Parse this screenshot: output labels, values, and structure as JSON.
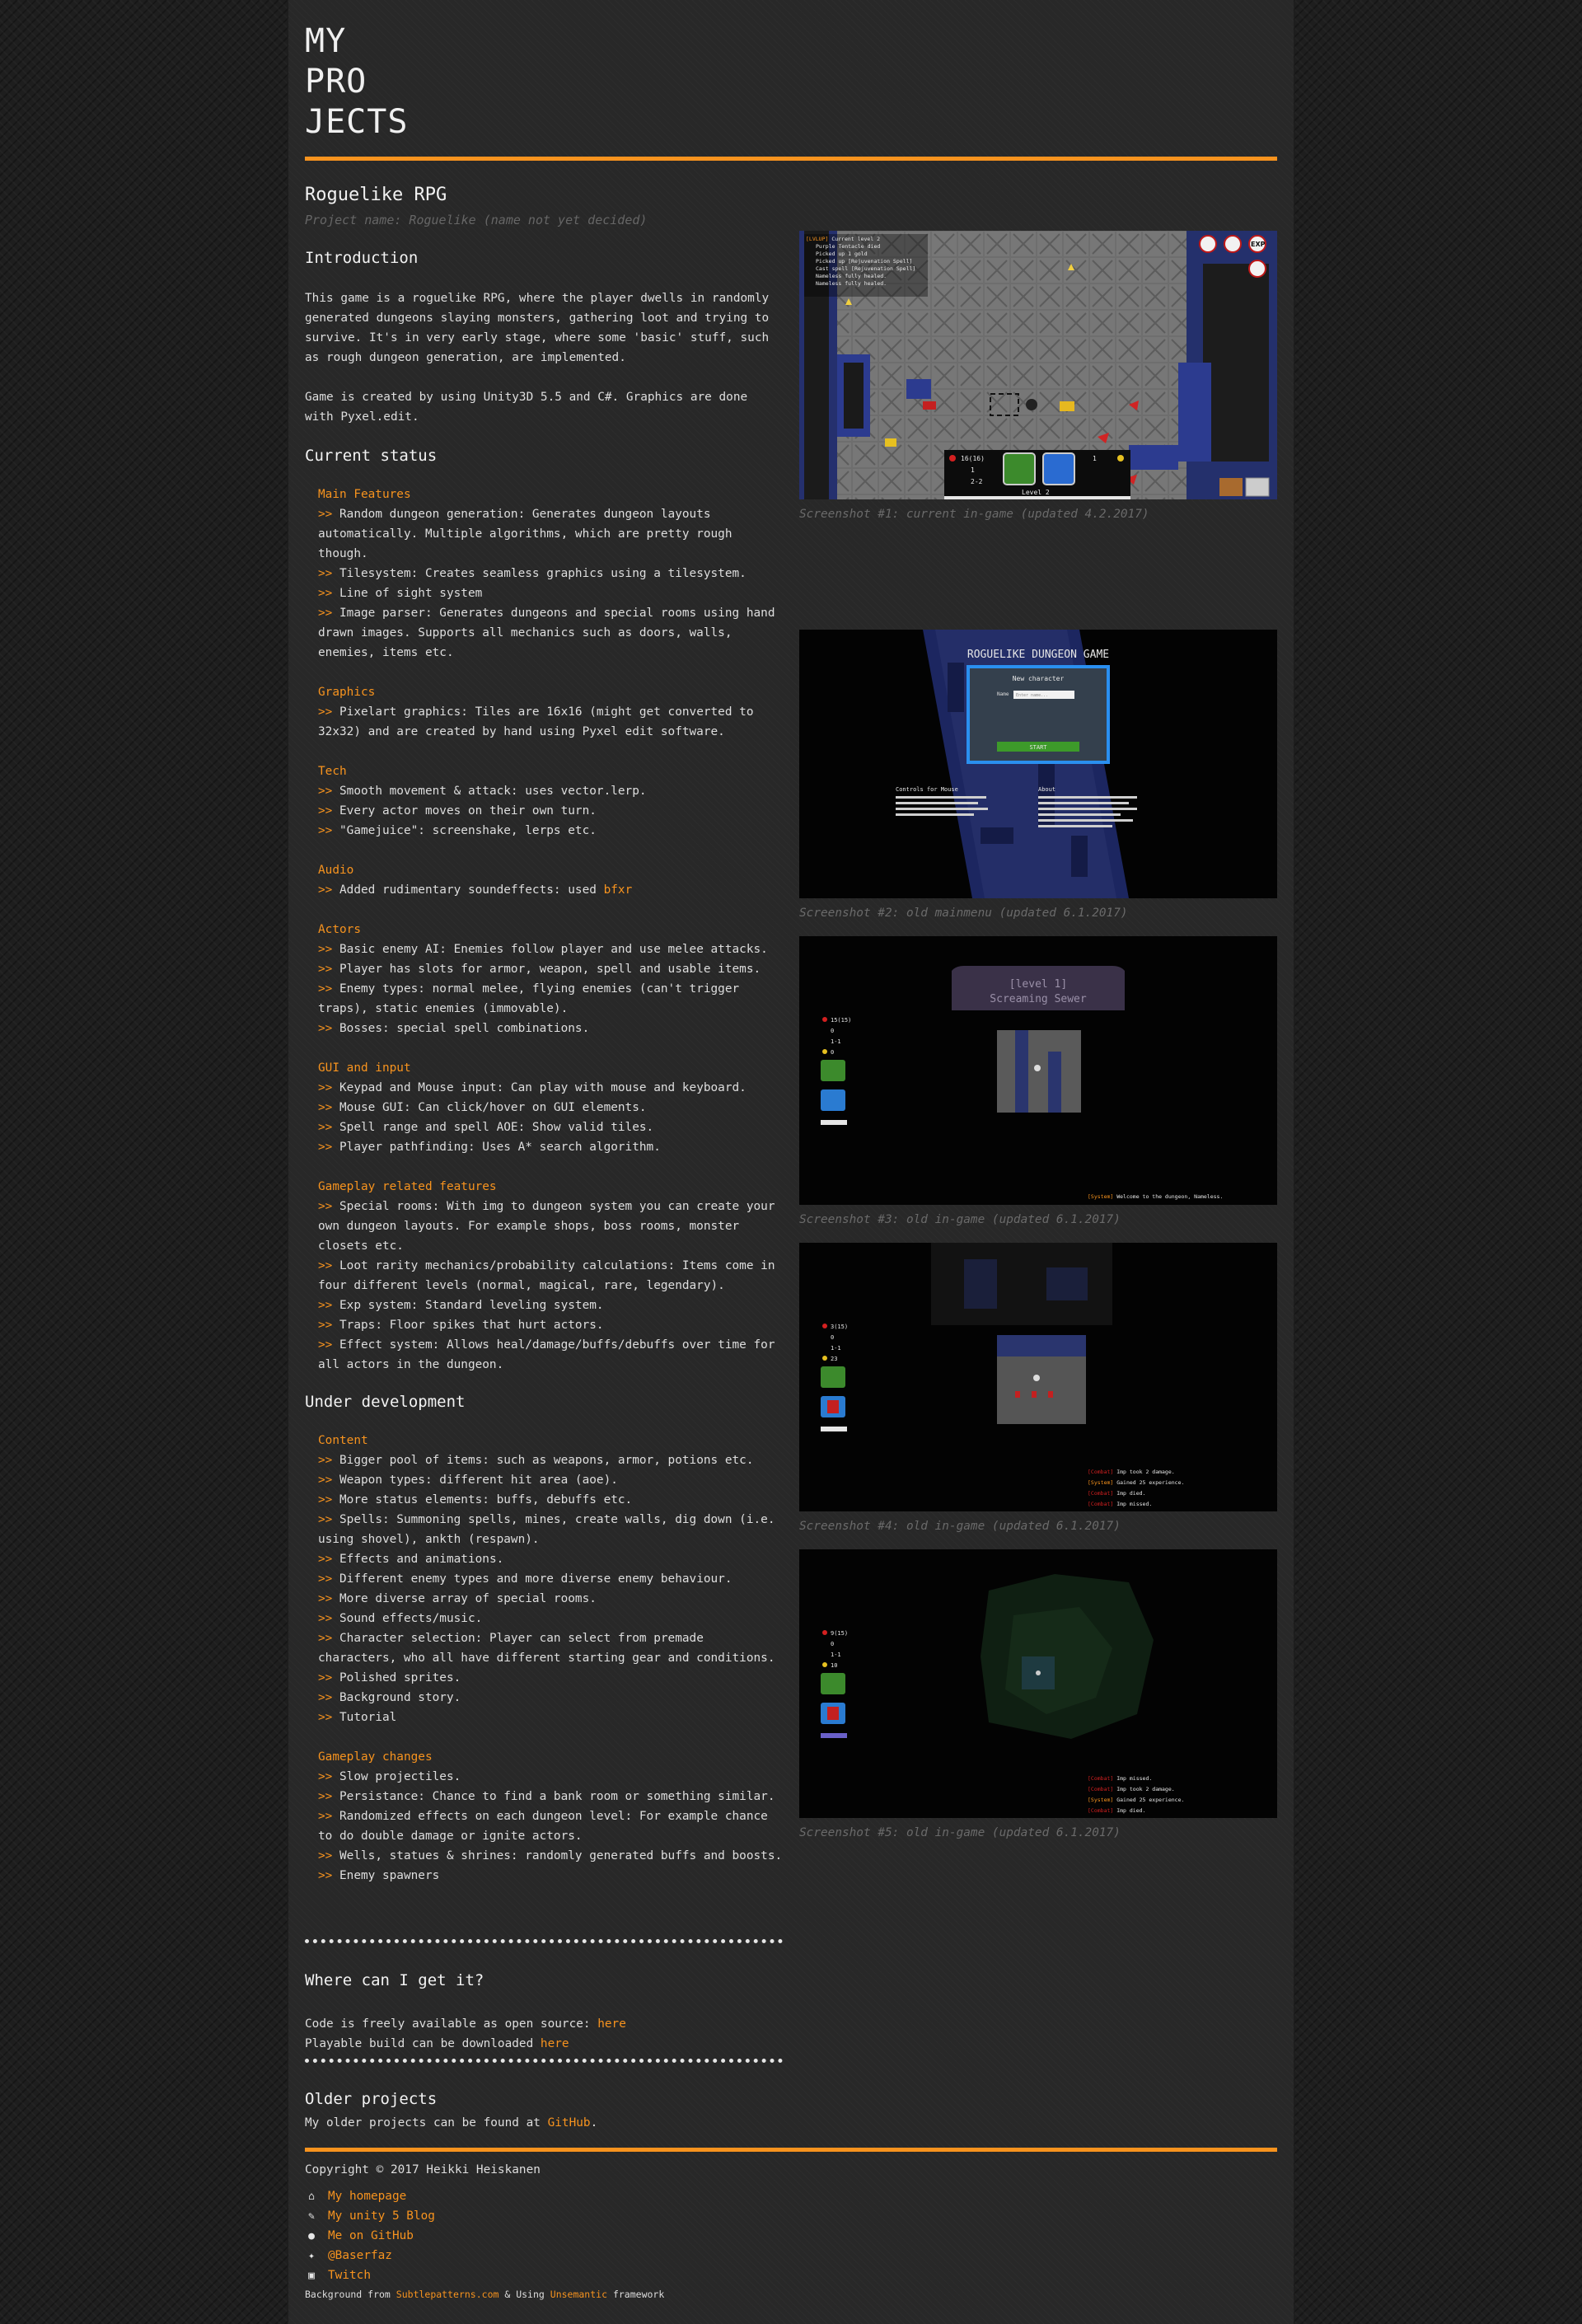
{
  "brand": {
    "line1": "MY",
    "line2": "PRO",
    "line3": "JECTS"
  },
  "colors": {
    "accent": "#f7931e",
    "background": "#282828",
    "text": "#e6e6e6"
  },
  "project": {
    "title": "Roguelike RPG",
    "name_note": "Project name: Roguelike (name not yet decided)",
    "intro_heading": "Introduction",
    "intro_p1": "This game is a roguelike RPG, where the player dwells in randomly generated dungeons slaying monsters, gathering loot and trying to survive. It's in very early stage, where some 'basic' stuff, such as rough dungeon generation, are implemented.",
    "intro_p2": "Game is created by using Unity3D 5.5 and C#. Graphics are done with Pyxel.edit.",
    "status_heading": "Current status",
    "dev_heading": "Under development"
  },
  "current_status": [
    {
      "category": "Main Features",
      "items": [
        "Random dungeon generation: Generates dungeon layouts automatically. Multiple algorithms, which are pretty rough though.",
        "Tilesystem: Creates seamless graphics using a tilesystem.",
        "Line of sight system",
        "Image parser: Generates dungeons and special rooms using hand drawn images. Supports all mechanics such as doors, walls, enemies, items etc."
      ]
    },
    {
      "category": "Graphics",
      "items": [
        "Pixelart graphics: Tiles are 16x16 (might get converted to 32x32) and are created by hand using Pyxel edit software."
      ]
    },
    {
      "category": "Tech",
      "items": [
        "Smooth movement & attack: uses vector.lerp.",
        "Every actor moves on their own turn.",
        "\"Gamejuice\": screenshake, lerps etc."
      ]
    },
    {
      "category": "Audio",
      "items": [
        "Added rudimentary soundeffects: used"
      ],
      "audio_link": "bfxr"
    },
    {
      "category": "Actors",
      "items": [
        "Basic enemy AI: Enemies follow player and use melee attacks.",
        "Player has slots for armor, weapon, spell and usable items.",
        "Enemy types: normal melee, flying enemies (can't trigger traps), static enemies (immovable).",
        "Bosses: special spell combinations."
      ]
    },
    {
      "category": "GUI and input",
      "items": [
        "Keypad and Mouse input: Can play with mouse and keyboard.",
        "Mouse GUI: Can click/hover on GUI elements.",
        "Spell range and spell AOE: Show valid tiles.",
        "Player pathfinding: Uses A* search algorithm."
      ]
    },
    {
      "category": "Gameplay related features",
      "items": [
        "Special rooms: With img to dungeon system you can create your own dungeon layouts. For example shops, boss rooms, monster closets etc.",
        "Loot rarity mechanics/probability calculations: Items come in four different levels (normal, magical, rare, legendary).",
        "Exp system: Standard leveling system.",
        "Traps: Floor spikes that hurt actors.",
        "Effect system: Allows heal/damage/buffs/debuffs over time for all actors in the dungeon."
      ]
    }
  ],
  "under_development": [
    {
      "category": "Content",
      "items": [
        "Bigger pool of items: such as weapons, armor, potions etc.",
        "Weapon types: different hit area (aoe).",
        "More status elements: buffs, debuffs etc.",
        "Spells: Summoning spells, mines, create walls, dig down (i.e. using shovel), ankth (respawn).",
        "Effects and animations.",
        "Different enemy types and more diverse enemy behaviour.",
        "More diverse array of special rooms.",
        "Sound effects/music.",
        "Character selection: Player can select from premade characters, who all have different starting gear and conditions.",
        "Polished sprites.",
        "Background story.",
        "Tutorial"
      ]
    },
    {
      "category": "Gameplay changes",
      "items": [
        "Slow projectiles.",
        "Persistance: Chance to find a bank room or something similar.",
        "Randomized effects on each dungeon level: For example chance to do double damage or ignite actors.",
        "Wells, statues & shrines: randomly generated buffs and boosts.",
        "Enemy spawners"
      ]
    }
  ],
  "get_it": {
    "heading": "Where can I get it?",
    "line1": "Code is freely available as open source:",
    "line1_link": "here",
    "line2": "Playable build can be downloaded",
    "line2_link": "here"
  },
  "older": {
    "heading": "Older projects",
    "text": "My older projects can be found at",
    "link": "GitHub",
    "end": "."
  },
  "screenshots": [
    {
      "caption": "Screenshot #1: current in-game (updated 4.2.2017)",
      "hud": {
        "hp": "16(16)",
        "armor": "1",
        "attack": "2-2",
        "gold": "1",
        "level": "Level 2"
      },
      "log": [
        "[LVLUP] Current level 2",
        "Purple Tentacle died",
        "Picked up 1 gold",
        "Picked up [Rejuvenation Spell]",
        "Cast spell [Rejuvenation Spell]",
        "Nameless fully healed.",
        "Nameless fully healed."
      ],
      "buttons": [
        "EXP"
      ]
    },
    {
      "caption": "Screenshot #2: old mainmenu (updated 6.1.2017)",
      "title": "ROGUELIKE DUNGEON GAME",
      "dialog_title": "New character",
      "field_label": "Name",
      "field_placeholder": "Enter name...",
      "start": "START",
      "controls_heading": "Controls for Mouse",
      "about_heading": "About"
    },
    {
      "caption": "Screenshot #3: old in-game (updated 6.1.2017)",
      "banner_level": "[level 1]",
      "banner_name": "Screaming Sewer",
      "stats": [
        "15(15)",
        "0",
        "1-1",
        "0"
      ],
      "log": [
        {
          "tag": "[System]",
          "text": "Welcome to the dungeon, Nameless."
        }
      ]
    },
    {
      "caption": "Screenshot #4: old in-game (updated 6.1.2017)",
      "stats": [
        "3(15)",
        "0",
        "1-1",
        "23"
      ],
      "log": [
        {
          "tag": "[Combat]",
          "text": "Imp took 2 damage."
        },
        {
          "tag": "[System]",
          "text": "Gained 25 experience."
        },
        {
          "tag": "[Combat]",
          "text": "Imp died."
        },
        {
          "tag": "[Combat]",
          "text": "Imp missed."
        }
      ]
    },
    {
      "caption": "Screenshot #5: old in-game (updated 6.1.2017)",
      "stats": [
        "9(15)",
        "0",
        "1-1",
        "10"
      ],
      "log": [
        {
          "tag": "[Combat]",
          "text": "Imp missed."
        },
        {
          "tag": "[Combat]",
          "text": "Imp took 2 damage."
        },
        {
          "tag": "[System]",
          "text": "Gained 25 experience."
        },
        {
          "tag": "[Combat]",
          "text": "Imp died."
        }
      ]
    }
  ],
  "footer": {
    "copyright": "Copyright © 2017 Heikki Heiskanen",
    "links": [
      {
        "icon": "home-icon",
        "label": "My homepage"
      },
      {
        "icon": "edit-icon",
        "label": "My unity 5 Blog"
      },
      {
        "icon": "github-icon",
        "label": "Me on GitHub"
      },
      {
        "icon": "twitter-icon",
        "label": "@Baserfaz"
      },
      {
        "icon": "twitch-icon",
        "label": "Twitch"
      }
    ],
    "credit_pre": "Background from",
    "credit_link1": "Subtlepatterns.com",
    "credit_mid": "& Using",
    "credit_link2": "Unsemantic",
    "credit_post": "framework"
  }
}
